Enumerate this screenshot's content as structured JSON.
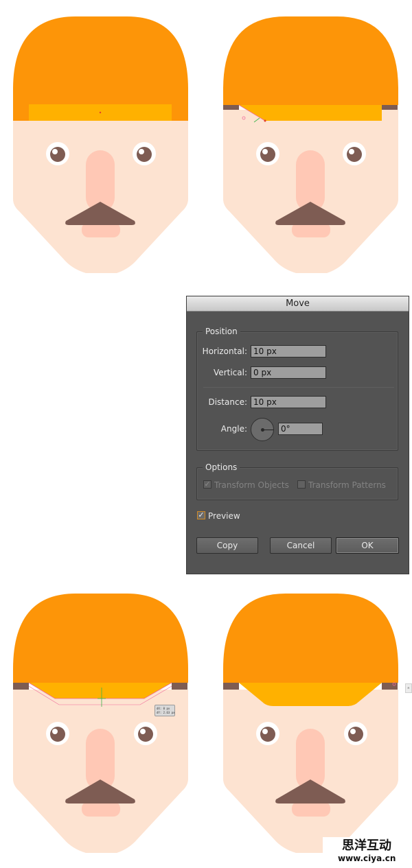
{
  "colors": {
    "hat": "#fd9508",
    "hat_band": "#ffb100",
    "skin": "#fde3d1",
    "nose": "#ffc8b5",
    "hair": "#7e5c53",
    "mouth": "#ffc8b5",
    "dialog_bg": "#535353",
    "preview_accent": "#d08a25"
  },
  "dialog": {
    "title": "Move",
    "position_legend": "Position",
    "horizontal_label": "Horizontal:",
    "horizontal_value": "10 px",
    "vertical_label": "Vertical:",
    "vertical_value": "0 px",
    "distance_label": "Distance:",
    "distance_value": "10 px",
    "angle_label": "Angle:",
    "angle_value": "0°",
    "options_legend": "Options",
    "transform_objects": "Transform Objects",
    "transform_patterns": "Transform Patterns",
    "transform_objects_checked": true,
    "transform_patterns_checked": false,
    "preview": "Preview",
    "preview_checked": true,
    "copy": "Copy",
    "cancel": "Cancel",
    "ok": "OK"
  },
  "tooltip": {
    "line1": "dX: 0 px",
    "line2": "dY: 2.63 px"
  },
  "watermark": {
    "chinese": "思洋互动",
    "url": "www.ciya.cn"
  }
}
